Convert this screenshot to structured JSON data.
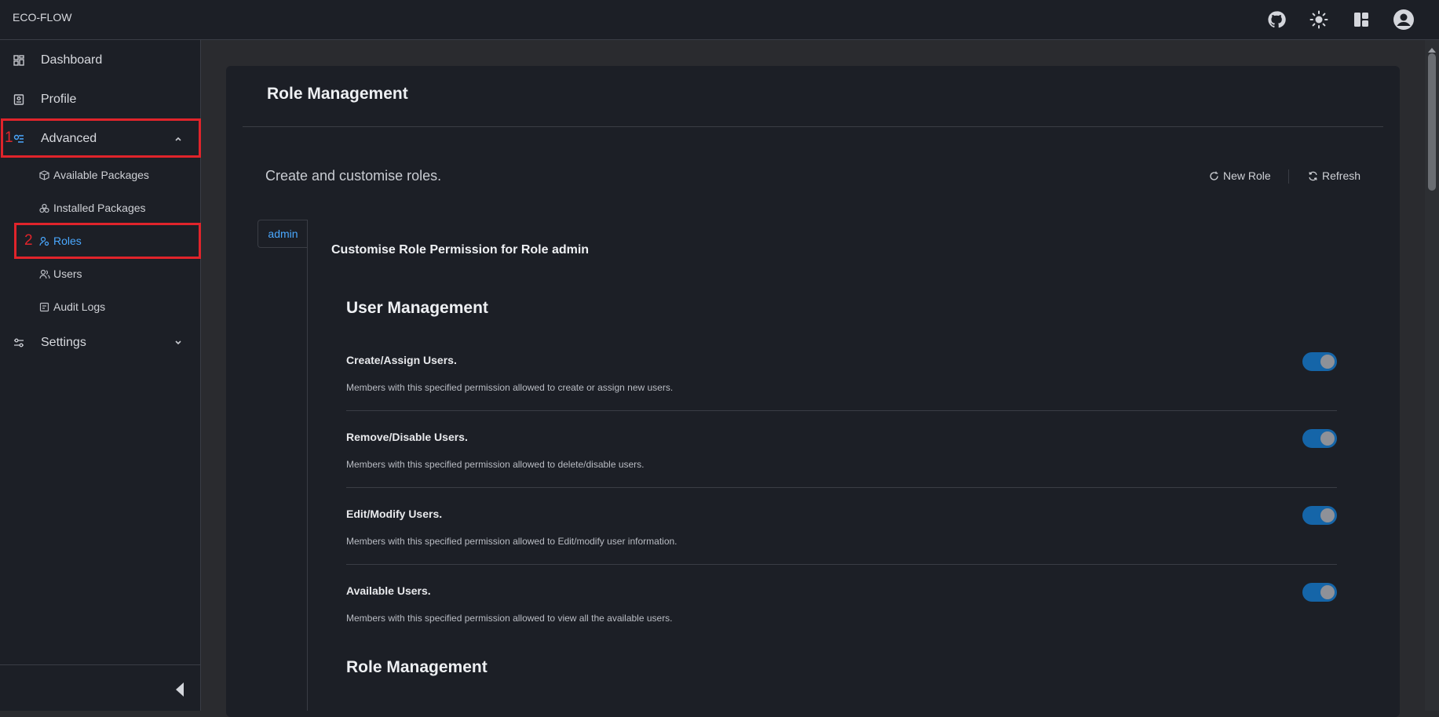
{
  "app": {
    "title": "ECO-FLOW"
  },
  "topbar": {
    "icons": [
      "github-icon",
      "sun-icon",
      "layout-icon",
      "account-icon"
    ]
  },
  "sidebar": {
    "items": [
      {
        "label": "Dashboard",
        "icon": "dashboard-icon"
      },
      {
        "label": "Profile",
        "icon": "profile-icon"
      },
      {
        "label": "Advanced",
        "icon": "advanced-icon",
        "expanded": true
      },
      {
        "label": "Settings",
        "icon": "settings-icon",
        "expanded": false
      }
    ],
    "advanced_children": [
      {
        "label": "Available Packages",
        "icon": "package-icon"
      },
      {
        "label": "Installed Packages",
        "icon": "installed-packages-icon"
      },
      {
        "label": "Roles",
        "icon": "roles-icon",
        "active": true
      },
      {
        "label": "Users",
        "icon": "users-icon"
      },
      {
        "label": "Audit Logs",
        "icon": "audit-logs-icon"
      }
    ],
    "annotations": [
      "1",
      "2"
    ]
  },
  "main": {
    "title": "Role Management",
    "subtitle": "Create and customise roles.",
    "actions": {
      "new_role": "New Role",
      "refresh": "Refresh"
    },
    "tabs": [
      {
        "label": "admin",
        "active": true
      }
    ],
    "customise_title": "Customise Role Permission for Role admin",
    "sections": [
      {
        "heading": "User Management",
        "permissions": [
          {
            "title": "Create/Assign Users.",
            "description": "Members with this specified permission allowed to create or assign new users.",
            "enabled": true
          },
          {
            "title": "Remove/Disable Users.",
            "description": "Members with this specified permission allowed to delete/disable users.",
            "enabled": true
          },
          {
            "title": "Edit/Modify Users.",
            "description": "Members with this specified permission allowed to Edit/modify user information.",
            "enabled": true
          },
          {
            "title": "Available Users.",
            "description": "Members with this specified permission allowed to view all the available users.",
            "enabled": true
          }
        ]
      },
      {
        "heading": "Role Management",
        "permissions": []
      }
    ]
  },
  "colors": {
    "background": "#1c1f26",
    "accent": "#4aa8ff",
    "toggle_on": "#1565a8",
    "annotation": "#e0242b"
  }
}
